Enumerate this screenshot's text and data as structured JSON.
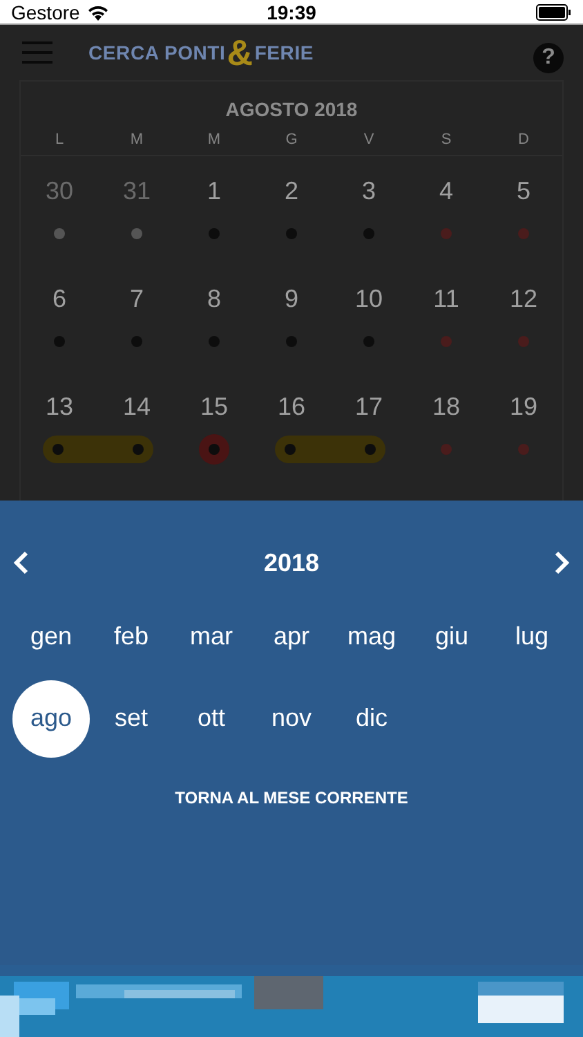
{
  "status_bar": {
    "carrier": "Gestore",
    "time": "19:39"
  },
  "header": {
    "logo_left": "CERCA PONTI",
    "logo_mark": "&",
    "logo_right": "FERIE",
    "help": "?"
  },
  "calendar": {
    "title": "AGOSTO 2018",
    "weekdays": [
      "L",
      "M",
      "M",
      "G",
      "V",
      "S",
      "D"
    ],
    "days": [
      {
        "label": "30",
        "muted": true,
        "color": "#555555",
        "kind": "plain"
      },
      {
        "label": "31",
        "muted": true,
        "color": "#555555",
        "kind": "plain"
      },
      {
        "label": "1",
        "muted": false,
        "color": "#0d0d0d",
        "kind": "plain"
      },
      {
        "label": "2",
        "muted": false,
        "color": "#0d0d0d",
        "kind": "plain"
      },
      {
        "label": "3",
        "muted": false,
        "color": "#0d0d0d",
        "kind": "plain"
      },
      {
        "label": "4",
        "muted": false,
        "color": "#4a1c1c",
        "kind": "plain"
      },
      {
        "label": "5",
        "muted": false,
        "color": "#4a1c1c",
        "kind": "plain"
      },
      {
        "label": "6",
        "muted": false,
        "color": "#0d0d0d",
        "kind": "plain"
      },
      {
        "label": "7",
        "muted": false,
        "color": "#0d0d0d",
        "kind": "plain"
      },
      {
        "label": "8",
        "muted": false,
        "color": "#0d0d0d",
        "kind": "plain"
      },
      {
        "label": "9",
        "muted": false,
        "color": "#0d0d0d",
        "kind": "plain"
      },
      {
        "label": "10",
        "muted": false,
        "color": "#0d0d0d",
        "kind": "plain"
      },
      {
        "label": "11",
        "muted": false,
        "color": "#4a1c1c",
        "kind": "plain"
      },
      {
        "label": "12",
        "muted": false,
        "color": "#4a1c1c",
        "kind": "plain"
      },
      {
        "label": "13",
        "muted": false,
        "color": "#0d0d0d",
        "kind": "range-start"
      },
      {
        "label": "14",
        "muted": false,
        "color": "#0d0d0d",
        "kind": "range-end"
      },
      {
        "label": "15",
        "muted": false,
        "color": "#0d0d0d",
        "kind": "holiday"
      },
      {
        "label": "16",
        "muted": false,
        "color": "#0d0d0d",
        "kind": "range-start"
      },
      {
        "label": "17",
        "muted": false,
        "color": "#0d0d0d",
        "kind": "range-end"
      },
      {
        "label": "18",
        "muted": false,
        "color": "#4a1c1c",
        "kind": "plain"
      },
      {
        "label": "19",
        "muted": false,
        "color": "#4a1c1c",
        "kind": "plain"
      }
    ]
  },
  "month_picker": {
    "year": "2018",
    "months": [
      {
        "label": "gen",
        "selected": false
      },
      {
        "label": "feb",
        "selected": false
      },
      {
        "label": "mar",
        "selected": false
      },
      {
        "label": "apr",
        "selected": false
      },
      {
        "label": "mag",
        "selected": false
      },
      {
        "label": "giu",
        "selected": false
      },
      {
        "label": "lug",
        "selected": false
      },
      {
        "label": "ago",
        "selected": true
      },
      {
        "label": "set",
        "selected": false
      },
      {
        "label": "ott",
        "selected": false
      },
      {
        "label": "nov",
        "selected": false
      },
      {
        "label": "dic",
        "selected": false
      }
    ],
    "current_month_button": "TORNA AL MESE CORRENTE"
  }
}
